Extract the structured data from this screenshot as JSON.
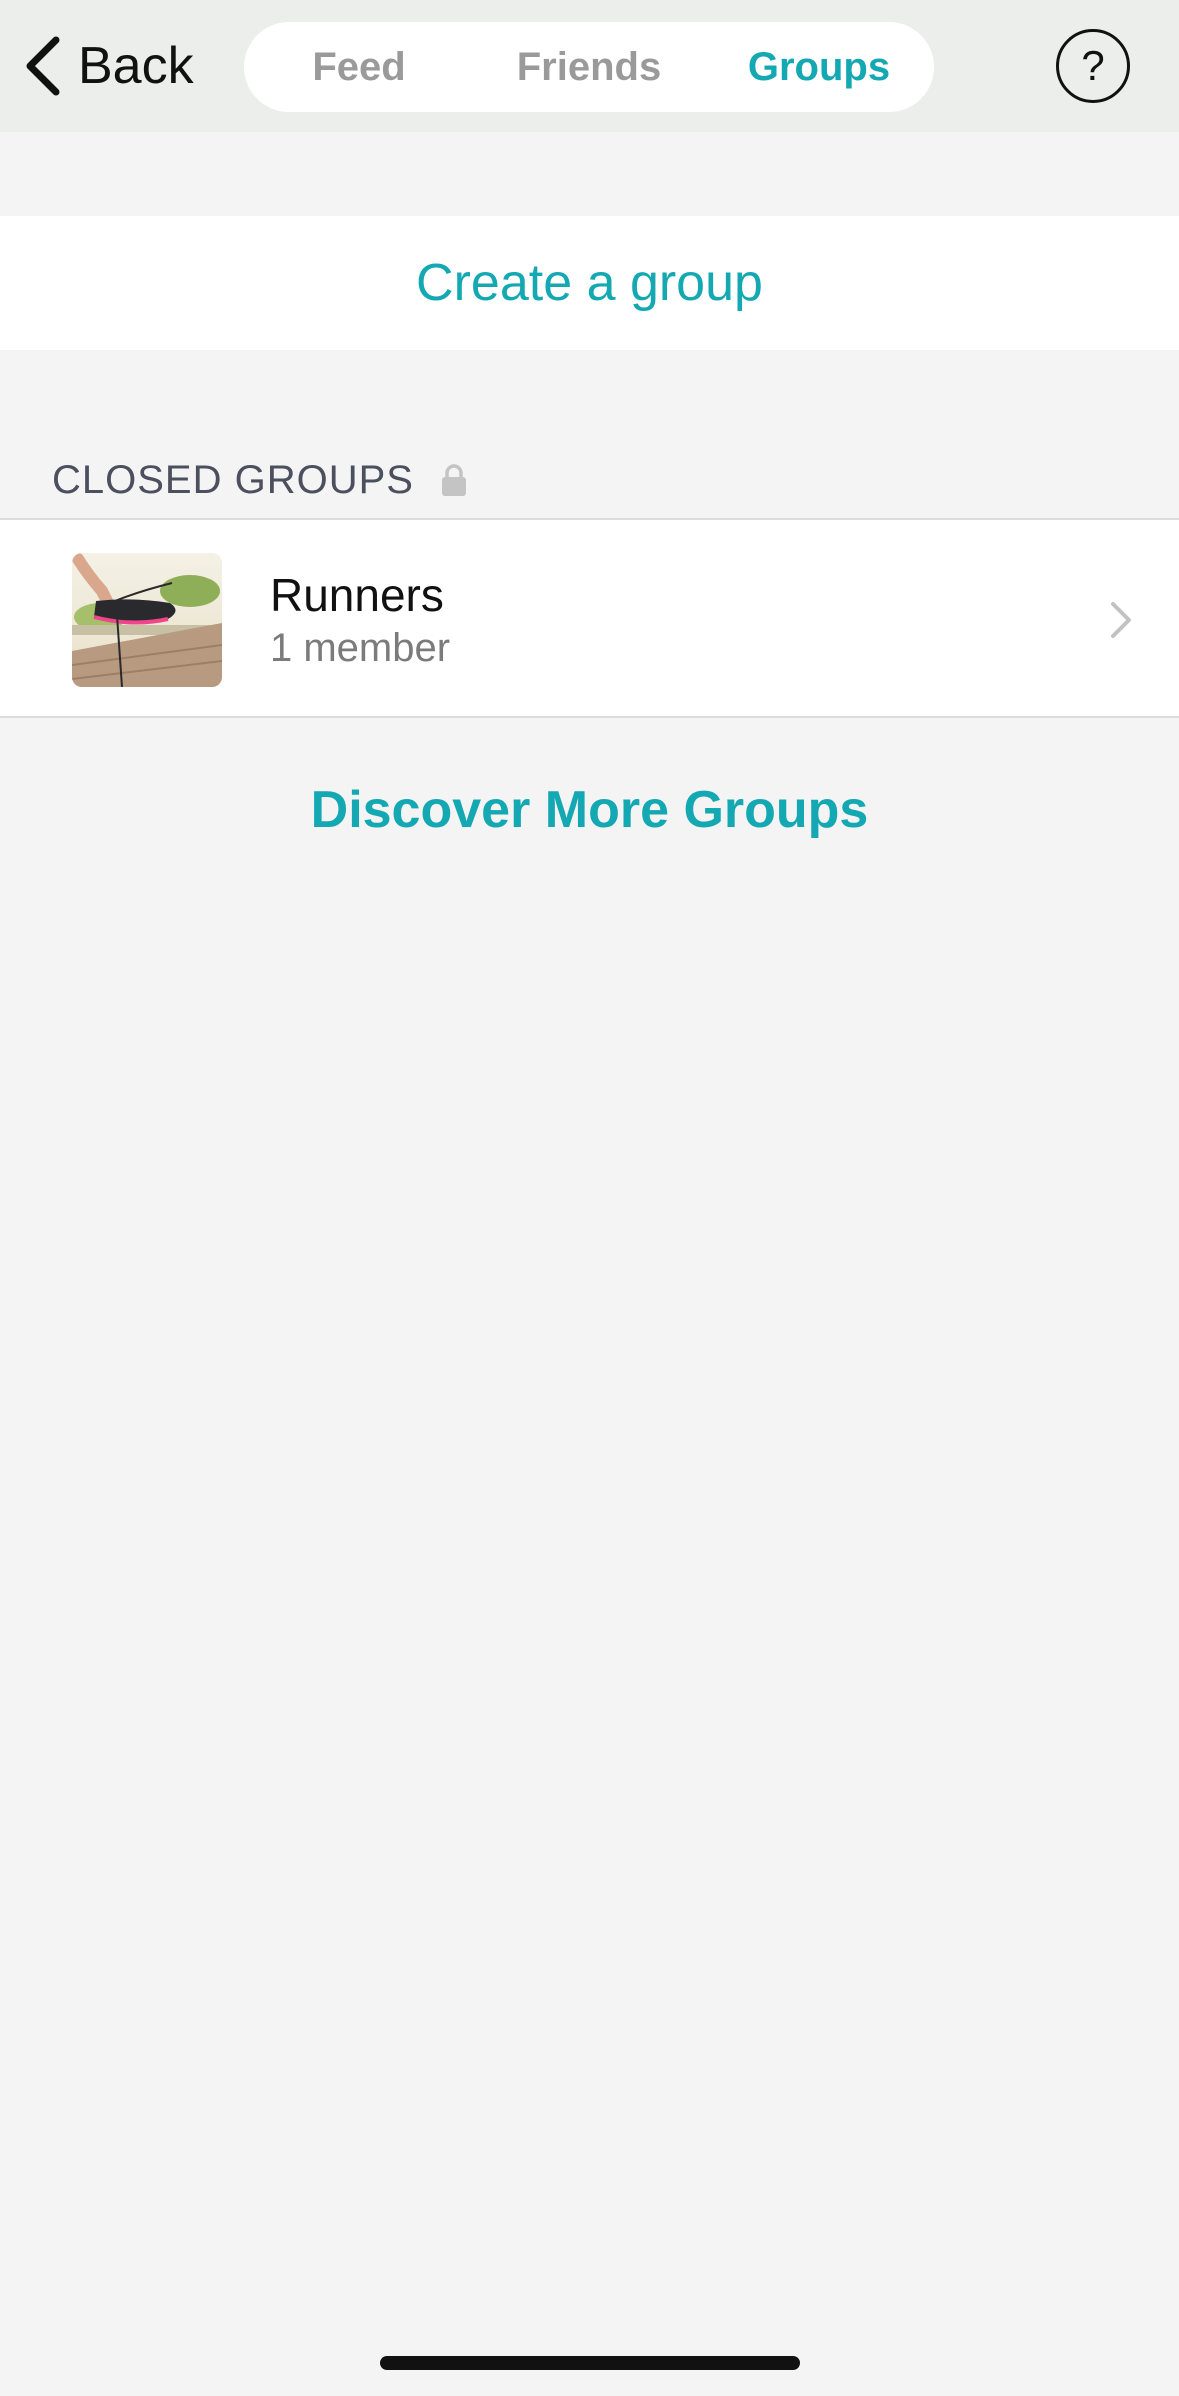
{
  "nav": {
    "back_label": "Back",
    "tabs": [
      {
        "label": "Feed",
        "active": false
      },
      {
        "label": "Friends",
        "active": false
      },
      {
        "label": "Groups",
        "active": true
      }
    ],
    "help_label": "?"
  },
  "actions": {
    "create_group_label": "Create a group",
    "discover_label": "Discover More Groups"
  },
  "section": {
    "title": "CLOSED GROUPS",
    "icon": "lock-icon"
  },
  "groups": [
    {
      "name": "Runners",
      "members": "1 member",
      "icon": "chevron-right-icon"
    }
  ],
  "colors": {
    "accent": "#14a8b3",
    "nav_bg": "#eceeec",
    "page_bg": "#f4f4f4",
    "inactive_tab": "#9a9a9a"
  }
}
